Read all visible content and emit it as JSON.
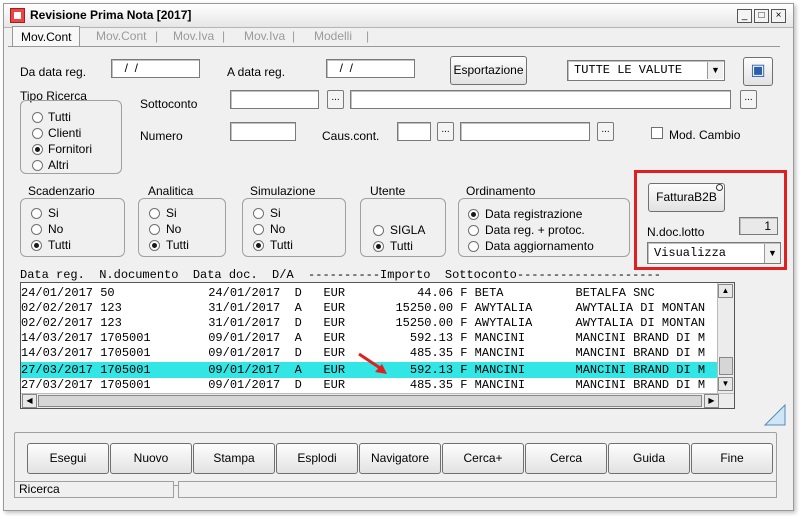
{
  "window": {
    "title": "Revisione Prima Nota [2017]",
    "controls": [
      "_",
      "□",
      "×"
    ]
  },
  "tabs": [
    "Mov.Cont",
    "Mov.Cont",
    "Mov.Iva",
    "Mov.Iva",
    "Modelli"
  ],
  "filters": {
    "da_data_label": "Da data reg.",
    "da_data_value": "  /  /",
    "a_data_label": "A data reg.",
    "a_data_value": "  /  /",
    "esportazione_label": "Esportazione",
    "valute_value": "TUTTE LE VALUTE",
    "tipo_ricerca_label": "Tipo Ricerca",
    "tipo_ricerca_options": [
      "Tutti",
      "Clienti",
      "Fornitori",
      "Altri"
    ],
    "tipo_ricerca_selected": 2,
    "sottoconto_label": "Sottoconto",
    "numero_label": "Numero",
    "caus_cont_label": "Caus.cont.",
    "mod_cambio_label": "Mod. Cambio",
    "dots": "..."
  },
  "groups": {
    "scadenzario": {
      "label": "Scadenzario",
      "options": [
        "Si",
        "No",
        "Tutti"
      ],
      "selected": 2
    },
    "analitica": {
      "label": "Analitica",
      "options": [
        "Si",
        "No",
        "Tutti"
      ],
      "selected": 2
    },
    "simulazione": {
      "label": "Simulazione",
      "options": [
        "Si",
        "No",
        "Tutti"
      ],
      "selected": 2
    },
    "utente": {
      "label": "Utente",
      "options": [
        "SIGLA",
        "Tutti"
      ],
      "selected": 1
    },
    "ordinamento": {
      "label": "Ordinamento",
      "options": [
        "Data registrazione",
        "Data reg. + protoc.",
        "Data aggiornamento"
      ],
      "selected": 0
    }
  },
  "fattura": {
    "button_label": "FatturaB2B",
    "ndoc_label": "N.doc.lotto",
    "ndoc_value": "1",
    "visualizza_value": "Visualizza"
  },
  "grid": {
    "header": "Data reg.  N.documento  Data doc.  D/A  ----------Importo  Sottoconto--------------------",
    "rows": [
      "24/01/2017 50             24/01/2017  D   EUR          44.06 F BETA          BETALFA SNC",
      "02/02/2017 123            31/01/2017  A   EUR       15250.00 F AWYTALIA      AWYTALIA DI MONTAN",
      "02/02/2017 123            31/01/2017  D   EUR       15250.00 F AWYTALIA      AWYTALIA DI MONTAN",
      "14/03/2017 1705001        09/01/2017  A   EUR         592.13 F MANCINI       MANCINI BRAND DI M",
      "14/03/2017 1705001        09/01/2017  D   EUR         485.35 F MANCINI       MANCINI BRAND DI M",
      "27/03/2017 1705001        09/01/2017  A   EUR         592.13 F MANCINI       MANCINI BRAND DI M",
      "27/03/2017 1705001        09/01/2017  D   EUR         485.35 F MANCINI       MANCINI BRAND DI M"
    ],
    "selected_row": 5
  },
  "buttons": [
    "Esegui",
    "Nuovo",
    "Stampa",
    "Esplodi",
    "Navigatore",
    "Cerca+",
    "Cerca",
    "Guida",
    "Fine"
  ],
  "status": {
    "left": "Ricerca",
    "right": ""
  },
  "colors": {
    "selection": "#33e6e6",
    "highlight": "#e02020"
  }
}
